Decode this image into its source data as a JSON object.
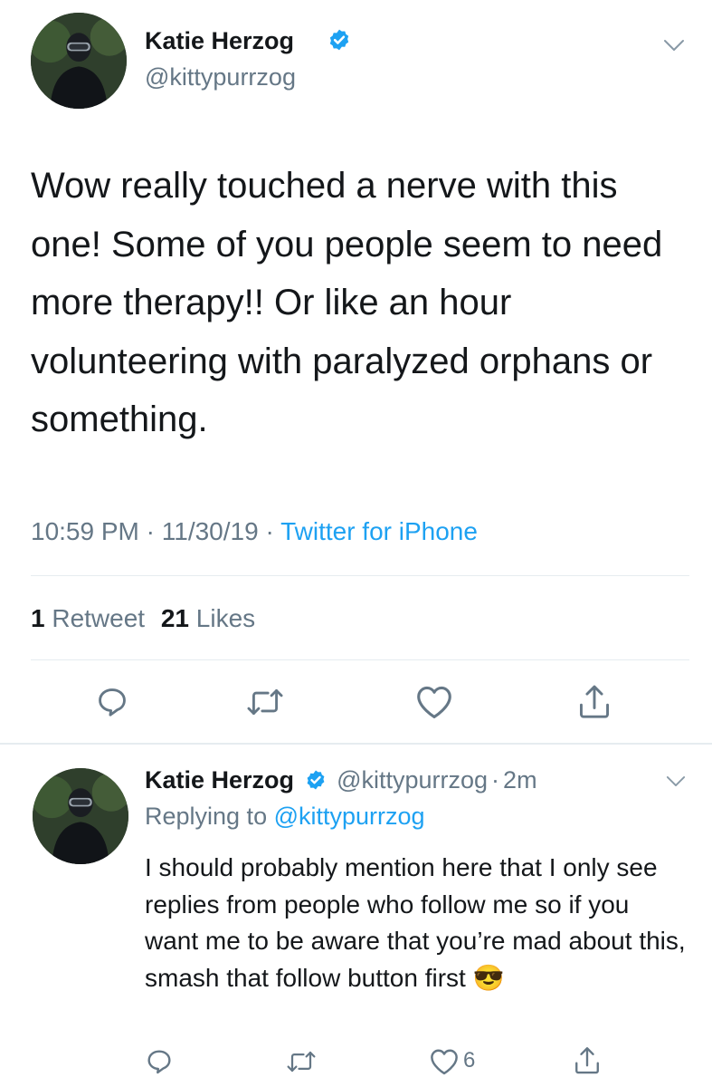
{
  "main_tweet": {
    "author_name": "Katie Herzog",
    "author_handle": "@kittypurrzog",
    "text": "Wow really touched a nerve with this one! Some of you people seem to need more therapy!! Or like an hour volunteering with paralyzed orphans or something.",
    "time": "10:59 PM",
    "date": "11/30/19",
    "separator": "·",
    "source": "Twitter for iPhone",
    "retweet_count": "1",
    "retweet_label": "Retweet",
    "like_count": "21",
    "like_label": "Likes"
  },
  "reply_tweet": {
    "author_name": "Katie Herzog",
    "author_handle": "@kittypurrzog",
    "separator": "·",
    "age": "2m",
    "replying_prefix": "Replying to",
    "replying_to": "@kittypurrzog",
    "text": "I should probably mention here that I only see replies from people who follow me so if you want me to be aware that you’re mad about this, smash that follow button first",
    "emoji": "😎",
    "like_count": "6"
  },
  "icons": {
    "verified": "verified-badge-icon",
    "chevron": "chevron-down-icon",
    "reply": "reply-icon",
    "retweet": "retweet-icon",
    "like": "heart-icon",
    "share": "share-icon"
  },
  "colors": {
    "link": "#1da1f2",
    "muted": "#657786",
    "text": "#14171a",
    "divider": "#e6ecf0"
  }
}
